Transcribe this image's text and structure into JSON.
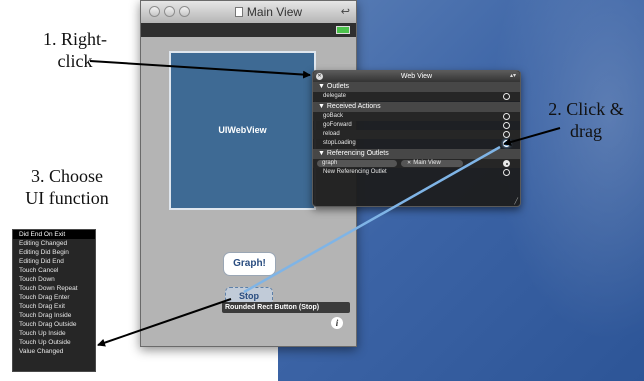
{
  "window": {
    "title": "Main View"
  },
  "webview": {
    "label": "UIWebView"
  },
  "buttons": {
    "graph": "Graph!",
    "stop": "Stop",
    "stop_tooltip": "Rounded Rect Button (Stop)"
  },
  "connections_panel": {
    "title": "Web View",
    "sections": {
      "outlets": "Outlets",
      "received_actions": "Received Actions",
      "referencing_outlets": "Referencing Outlets"
    },
    "outlets": [
      "delegate"
    ],
    "actions": [
      "goBack",
      "goForward",
      "reload",
      "stopLoading"
    ],
    "referencing": {
      "source": "graph",
      "target": "Main View",
      "new": "New Referencing Outlet"
    }
  },
  "events_menu": {
    "items": [
      "Did End On Exit",
      "Editing Changed",
      "Editing Did Begin",
      "Editing Did End",
      "Touch Cancel",
      "Touch Down",
      "Touch Down Repeat",
      "Touch Drag Enter",
      "Touch Drag Exit",
      "Touch Drag Inside",
      "Touch Drag Outside",
      "Touch Up Inside",
      "Touch Up Outside",
      "Value Changed"
    ],
    "selected": "Did End On Exit"
  },
  "annotations": {
    "step1_line1": "1. Right-",
    "step1_line2": "click",
    "step2_line1": "2. Click &",
    "step2_line2": "drag",
    "step3_line1": "3. Choose",
    "step3_line2": "UI function"
  },
  "colors": {
    "desktop": "#3c64a6",
    "webview": "#3e6a94",
    "connection_line": "#7fb4e6",
    "panel": "#1c1c1c"
  }
}
